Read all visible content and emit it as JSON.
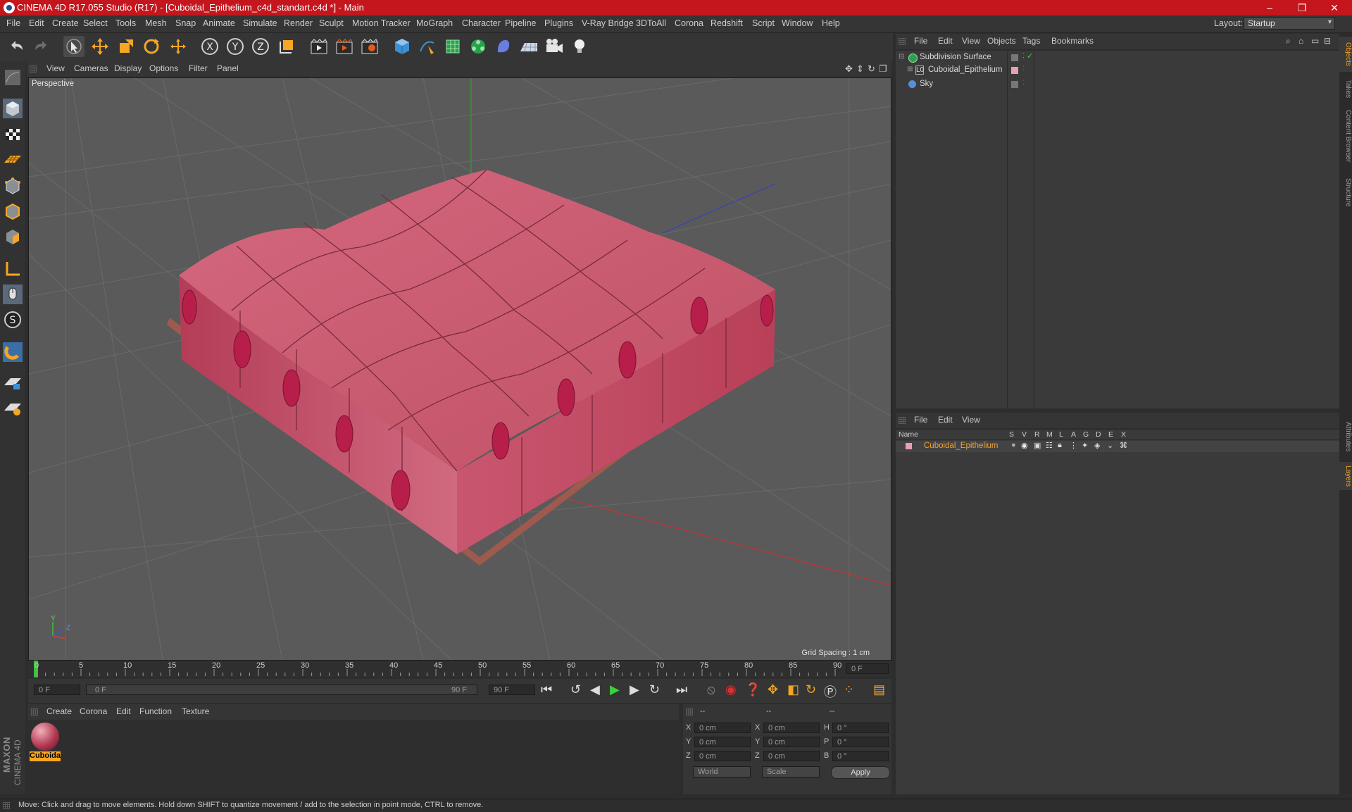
{
  "window": {
    "title": "CINEMA 4D R17.055 Studio (R17) - [Cuboidal_Epithelium_c4d_standart.c4d *] - Main",
    "minimize": "–",
    "restore": "❐",
    "close": "✕"
  },
  "menubar": {
    "items": [
      "File",
      "Edit",
      "Create",
      "Select",
      "Tools",
      "Mesh",
      "Snap",
      "Animate",
      "Simulate",
      "Render",
      "Sculpt",
      "Motion Tracker",
      "MoGraph",
      "Character",
      "Pipeline",
      "Plugins",
      "V-Ray Bridge",
      "3DToAll",
      "Corona",
      "Redshift",
      "Script",
      "Window",
      "Help"
    ],
    "layout_label": "Layout:",
    "layout_value": "Startup"
  },
  "viewport": {
    "menu": [
      "View",
      "Cameras",
      "Display",
      "Options",
      "Filter",
      "Panel"
    ],
    "label": "Perspective",
    "grid_spacing": "Grid Spacing : 1 cm",
    "axis_labels": {
      "y": "Y",
      "z": "Z",
      "x": "X"
    }
  },
  "timeline": {
    "ticks": [
      "0",
      "5",
      "10",
      "15",
      "20",
      "25",
      "30",
      "35",
      "40",
      "45",
      "50",
      "55",
      "60",
      "65",
      "70",
      "75",
      "80",
      "85",
      "90"
    ],
    "current_frame_field": "0 F",
    "start_field": "0 F",
    "range_start": "0 F",
    "range_end": "90 F",
    "end_field": "90 F"
  },
  "material_manager": {
    "menu": [
      "Create",
      "Corona",
      "Edit",
      "Function",
      "Texture"
    ],
    "materials": [
      {
        "label": "Cuboidal"
      }
    ]
  },
  "coordinates": {
    "header": [
      "--",
      "--",
      "--"
    ],
    "rows": [
      {
        "l1": "X",
        "v1": "0 cm",
        "l2": "X",
        "v2": "0 cm",
        "l3": "H",
        "v3": "0 °"
      },
      {
        "l1": "Y",
        "v1": "0 cm",
        "l2": "Y",
        "v2": "0 cm",
        "l3": "P",
        "v3": "0 °"
      },
      {
        "l1": "Z",
        "v1": "0 cm",
        "l2": "Z",
        "v2": "0 cm",
        "l3": "B",
        "v3": "0 °"
      }
    ],
    "world": "World",
    "scale": "Scale",
    "apply": "Apply"
  },
  "object_manager": {
    "menu": [
      "File",
      "Edit",
      "View",
      "Objects",
      "Tags",
      "Bookmarks"
    ],
    "objects": [
      {
        "name": "Subdivision Surface",
        "icon": "subdivision-icon"
      },
      {
        "name": "Cuboidal_Epithelium",
        "icon": "null-icon"
      },
      {
        "name": "Sky",
        "icon": "sky-icon"
      }
    ]
  },
  "layer_manager": {
    "menu": [
      "File",
      "Edit",
      "View"
    ],
    "columns": [
      "Name",
      "S",
      "V",
      "R",
      "M",
      "L",
      "A",
      "G",
      "D",
      "E",
      "X"
    ],
    "layers": [
      {
        "name": "Cuboidal_Epithelium"
      }
    ]
  },
  "side_tabs": [
    "Objects",
    "Takes",
    "Content Browser",
    "Structure",
    "Attributes",
    "Layers"
  ],
  "branding": {
    "line1": "MAXON",
    "line2": "CINEMA 4D"
  },
  "status": {
    "text": "Move: Click and drag to move elements. Hold down SHIFT to quantize movement / add to the selection in point mode, CTRL to remove."
  },
  "colors": {
    "title_bar": "#c4161c",
    "accent_orange": "#f5a623",
    "layer_name": "#f0a030"
  }
}
